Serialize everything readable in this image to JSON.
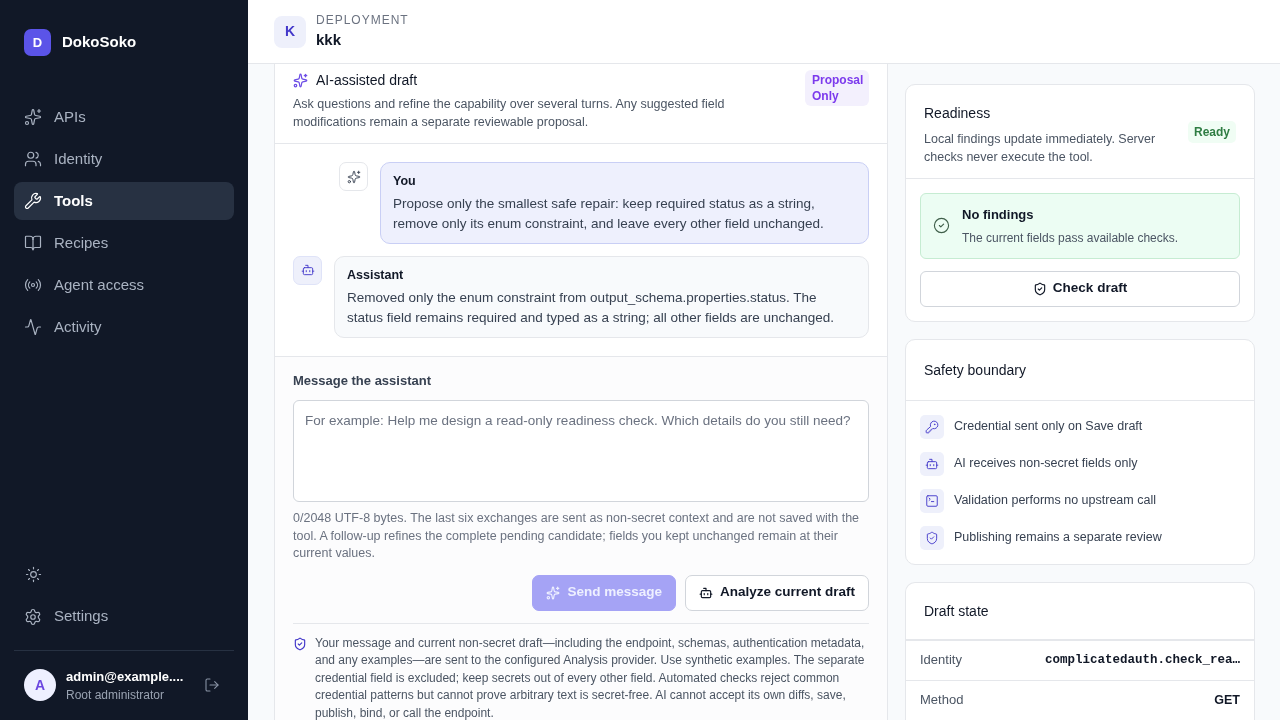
{
  "brand": {
    "initial": "D",
    "name": "DokoSoko"
  },
  "sidebar": {
    "items": [
      {
        "label": "APIs",
        "selected": false
      },
      {
        "label": "Identity",
        "selected": false
      },
      {
        "label": "Tools",
        "selected": true
      },
      {
        "label": "Recipes",
        "selected": false
      },
      {
        "label": "Agent access",
        "selected": false
      },
      {
        "label": "Activity",
        "selected": false
      }
    ],
    "settings": {
      "label": "Settings"
    },
    "user": {
      "initial": "A",
      "email": "admin@example....",
      "role": "Root administrator"
    }
  },
  "header": {
    "initial": "K",
    "eyebrow": "DEPLOYMENT",
    "title": "kkk"
  },
  "assistant_panel": {
    "title": "AI-assisted draft",
    "badge": "Proposal Only",
    "description": "Ask questions and refine the capability over several turns. Any suggested field modifications remain a separate reviewable proposal.",
    "messages": [
      {
        "kind": "user",
        "author": "You",
        "text": "Propose only the smallest safe repair: keep required status as a string, remove only its enum constraint, and leave every other field unchanged."
      },
      {
        "kind": "assistant",
        "author": "Assistant",
        "text": "Removed only the enum constraint from output_schema.properties.status. The status field remains required and typed as a string; all other fields are unchanged."
      }
    ],
    "composer": {
      "label": "Message the assistant",
      "placeholder": "For example: Help me design a read-only readiness check. Which details do you still need?",
      "hint": "0/2048 UTF-8 bytes. The last six exchanges are sent as non-secret context and are not saved with the tool. A follow-up refines the complete pending candidate; fields you kept unchanged remain at their current values.",
      "buttons": [
        {
          "label": "Send message",
          "kind": "primary",
          "disabled": true
        },
        {
          "label": "Analyze current draft",
          "kind": "secondary",
          "disabled": false
        }
      ]
    },
    "notice": "Your message and current non-secret draft—including the endpoint, schemas, authentication metadata, and any examples—are sent to the configured Analysis provider. Use synthetic examples. The separate credential field is excluded; keep secrets out of every other field. Automated checks reject common credential patterns but cannot prove arbitrary text is secret-free. AI cannot accept its own diffs, save, publish, bind, or call the endpoint."
  },
  "readiness": {
    "title": "Readiness",
    "description": "Local findings update immediately. Server checks never execute the tool.",
    "status": "Ready",
    "finding": {
      "title": "No findings",
      "text": "The current fields pass available checks."
    },
    "check_button": "Check draft"
  },
  "safety": {
    "title": "Safety boundary",
    "items": [
      {
        "text": "Credential sent only on Save draft"
      },
      {
        "text": "AI receives non-secret fields only"
      },
      {
        "text": "Validation performs no upstream call"
      },
      {
        "text": "Publishing remains a separate review"
      }
    ]
  },
  "draft_state": {
    "title": "Draft state",
    "rows": [
      {
        "label": "Identity",
        "value": "complicatedauth.check_rea…",
        "kind": "code"
      },
      {
        "label": "Method",
        "value": "GET",
        "kind": "text"
      }
    ]
  }
}
